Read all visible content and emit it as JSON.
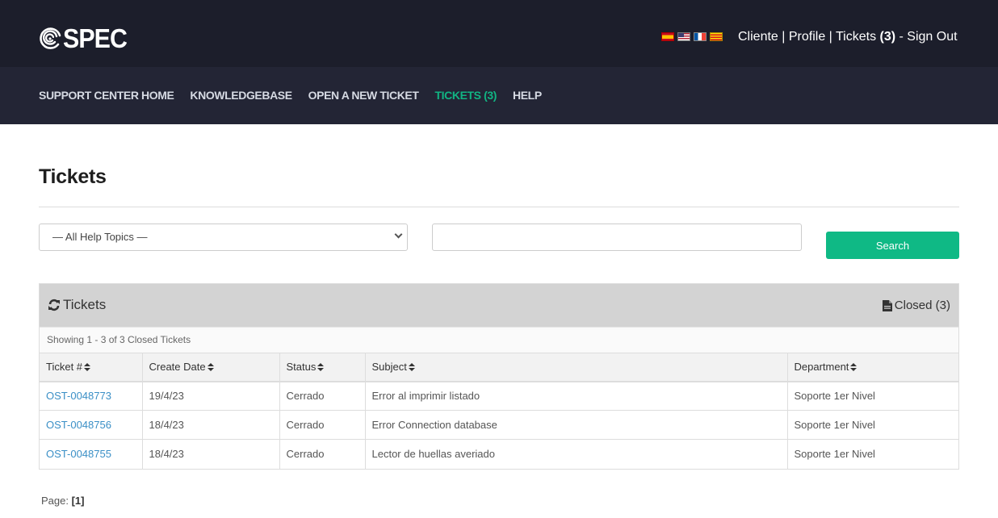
{
  "header": {
    "logo_text": "SPEC",
    "flags": [
      {
        "name": "flag-spanish",
        "cls": "flag-es"
      },
      {
        "name": "flag-english",
        "cls": "flag-us"
      },
      {
        "name": "flag-french",
        "cls": "flag-fr"
      },
      {
        "name": "flag-catalan",
        "cls": "flag-ca"
      }
    ],
    "user_links": {
      "client": "Cliente",
      "sep1": " | ",
      "profile": "Profile",
      "sep2": " | ",
      "tickets": "Tickets ",
      "tickets_count": "(3)",
      "sep3": " - ",
      "sign_out": "Sign Out"
    }
  },
  "nav": {
    "items": [
      {
        "label": "SUPPORT CENTER HOME"
      },
      {
        "label": "KNOWLEDGEBASE"
      },
      {
        "label": "OPEN A NEW TICKET"
      },
      {
        "label": "TICKETS (3)",
        "active": true
      },
      {
        "label": "HELP"
      }
    ],
    "active_color": "#11b583"
  },
  "page": {
    "title": "Tickets"
  },
  "filters": {
    "topic_selected": "— All Help Topics —",
    "search_value": "",
    "search_button": "Search",
    "accent_color": "#0fb985"
  },
  "panel": {
    "title": "Tickets",
    "closed_label": "Closed (3)",
    "showing": "Showing 1 - 3 of 3 Closed Tickets",
    "columns": [
      "Ticket #",
      "Create Date",
      "Status",
      "Subject",
      "Department"
    ],
    "rows": [
      {
        "ticket": "OST-0048773",
        "date": "19/4/23",
        "status": "Cerrado",
        "subject": "Error al imprimir listado",
        "department": "Soporte 1er Nivel"
      },
      {
        "ticket": "OST-0048756",
        "date": "18/4/23",
        "status": "Cerrado",
        "subject": "Error Connection database",
        "department": "Soporte 1er Nivel"
      },
      {
        "ticket": "OST-0048755",
        "date": "18/4/23",
        "status": "Cerrado",
        "subject": "Lector de huellas averiado",
        "department": "Soporte 1er Nivel"
      }
    ]
  },
  "pager": {
    "label": "Page: ",
    "current": "[1]"
  }
}
